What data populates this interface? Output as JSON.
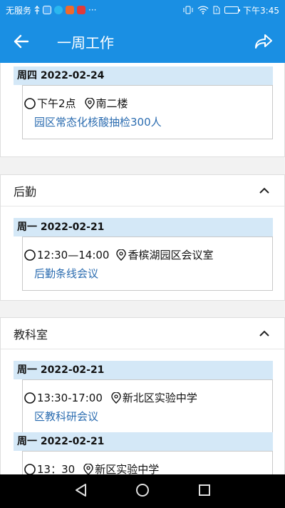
{
  "status_bar": {
    "carrier": "无服务",
    "more": "···",
    "time": "下午3:45"
  },
  "app_bar": {
    "title": "一周工作",
    "back_icon": "arrow-left-icon",
    "share_icon": "share-icon"
  },
  "sections": [
    {
      "title": "",
      "days": [
        {
          "date": "周四 2022-02-24",
          "events": [
            {
              "time": "下午2点",
              "location": "南二楼",
              "name": "园区常态化核酸抽检300人"
            }
          ]
        }
      ]
    },
    {
      "title": "后勤",
      "days": [
        {
          "date": "周一 2022-02-21",
          "events": [
            {
              "time": "12:30—14:00",
              "location": "香槟湖园区会议室",
              "name": "后勤条线会议"
            }
          ]
        }
      ]
    },
    {
      "title": "教科室",
      "days": [
        {
          "date": "周一 2022-02-21",
          "events": [
            {
              "time": "13:30-17:00",
              "location": "新北区实验中学",
              "name": "区教科研会议"
            }
          ]
        },
        {
          "date": "周一 2022-02-21",
          "events": [
            {
              "time": "13：30",
              "location": "新区实验中学",
              "name": ""
            }
          ]
        }
      ]
    }
  ],
  "colors": {
    "primary": "#1a8fe3",
    "day_bar": "#d4e8f7",
    "event_link": "#2b6cb0"
  }
}
